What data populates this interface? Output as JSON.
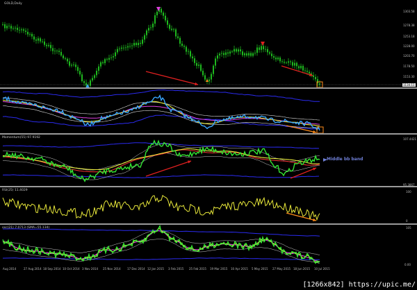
{
  "panes": {
    "main": {
      "label": "GOLD,Daily"
    },
    "bb": {
      "label": ""
    },
    "momentum": {
      "label": "Momentum(55) 97.9192"
    },
    "rsi": {
      "label": "RSI(25) 11.4029"
    },
    "osc": {
      "label": "osc(21) 7.0713 (SMA=55.134)"
    }
  },
  "price_scale": {
    "main": [
      "1303.58",
      "1278.38",
      "1253.18",
      "1228.00",
      "1203.70",
      "1178.50",
      "1153.30"
    ],
    "main_current": "1134.11",
    "momentum": [
      "107.4421",
      "95.3867"
    ],
    "rsi": [
      "100",
      "0"
    ],
    "osc": [
      "105",
      "0.00"
    ]
  },
  "time_axis": [
    "Aug 2014",
    "27 Aug 2014",
    "18 Sep 2014",
    "10 Oct 2014",
    "3 Nov 2014",
    "25 Nov 2014",
    "17 Dec 2014",
    "12 Jan 2015",
    "3 Feb 2015",
    "25 Feb 2015",
    "19 Mar 2015",
    "10 Apr 2015",
    "5 May 2015",
    "27 May 2015",
    "18 Jun 2015",
    "10 Jul 2015"
  ],
  "annotation": {
    "text": "Middle bb band"
  },
  "watermark": {
    "text": "[1266x842] https://upic.me/"
  },
  "colors": {
    "bg": "#000000",
    "candle": "#22cc22",
    "arrow": "#e02020",
    "band_blue": "#2b2bf0",
    "yellow": "#e8e83a",
    "cyan": "#3aa6ff",
    "magenta": "#e040e0",
    "orange": "#ff8c1a",
    "green_line": "#33e633",
    "red_line": "#e83030"
  }
}
